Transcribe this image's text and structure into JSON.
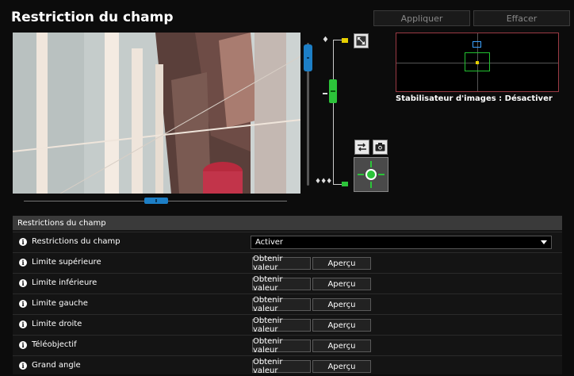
{
  "header": {
    "title": "Restriction du champ",
    "apply_label": "Appliquer",
    "clear_label": "Effacer"
  },
  "stabilizer": {
    "label": "Stabilisateur d'images : Désactiver"
  },
  "panel": {
    "title": "Restrictions du champ",
    "rows": [
      {
        "label": "Restrictions du champ",
        "type": "select",
        "value": "Activer"
      },
      {
        "label": "Limite supérieure",
        "type": "buttons",
        "get": "Obtenir valeur",
        "preview": "Aperçu"
      },
      {
        "label": "Limite inférieure",
        "type": "buttons",
        "get": "Obtenir valeur",
        "preview": "Aperçu"
      },
      {
        "label": "Limite gauche",
        "type": "buttons",
        "get": "Obtenir valeur",
        "preview": "Aperçu"
      },
      {
        "label": "Limite droite",
        "type": "buttons",
        "get": "Obtenir valeur",
        "preview": "Aperçu"
      },
      {
        "label": "Téléobjectif",
        "type": "buttons",
        "get": "Obtenir valeur",
        "preview": "Aperçu"
      },
      {
        "label": "Grand angle",
        "type": "buttons",
        "get": "Obtenir valeur",
        "preview": "Aperçu"
      }
    ]
  },
  "icons": {
    "info": "i",
    "tele": "♦",
    "wide": "♦♦♦"
  },
  "colors": {
    "accent_blue": "#1d7fc6",
    "zoom_green": "#2cc43a",
    "zoom_yellow": "#e7d000",
    "stab_border": "#9b3a44"
  }
}
